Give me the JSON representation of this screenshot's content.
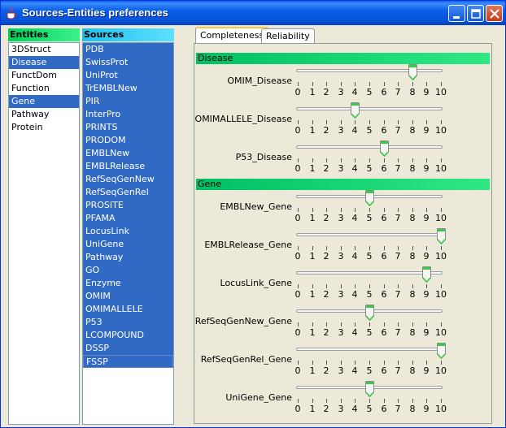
{
  "window": {
    "title": "Sources-Entities preferences"
  },
  "entities": {
    "header": "Entities",
    "items": [
      "3DStruct",
      "Disease",
      "FunctDom",
      "Function",
      "Gene",
      "Pathway",
      "Protein"
    ],
    "selected": [
      "Disease",
      "Gene"
    ]
  },
  "sources": {
    "header": "Sources",
    "items": [
      "PDB",
      "SwissProt",
      "UniProt",
      "TrEMBLNew",
      "PIR",
      "InterPro",
      "PRINTS",
      "PRODOM",
      "EMBLNew",
      "EMBLRelease",
      "RefSeqGenNew",
      "RefSeqGenRel",
      "PROSITE",
      "PFAMA",
      "LocusLink",
      "UniGene",
      "Pathway",
      "GO",
      "Enzyme",
      "OMIM",
      "OMIMALLELE",
      "P53",
      "LCOMPOUND",
      "DSSP",
      "FSSP"
    ]
  },
  "tabs": {
    "completeness": "Completeness",
    "reliability": "Reliability",
    "active": "Completeness"
  },
  "slider_scale": {
    "min": 0,
    "max": 10,
    "ticks": [
      "0",
      "1",
      "2",
      "3",
      "4",
      "5",
      "6",
      "7",
      "8",
      "9",
      "10"
    ]
  },
  "sections": [
    {
      "title": "Disease",
      "rows": [
        {
          "label": "OMIM_Disease",
          "value": 8
        },
        {
          "label": "OMIMALLELE_Disease",
          "value": 4
        },
        {
          "label": "P53_Disease",
          "value": 6
        }
      ]
    },
    {
      "title": "Gene",
      "rows": [
        {
          "label": "EMBLNew_Gene",
          "value": 5
        },
        {
          "label": "EMBLRelease_Gene",
          "value": 10
        },
        {
          "label": "LocusLink_Gene",
          "value": 9
        },
        {
          "label": "RefSeqGenNew_Gene",
          "value": 5
        },
        {
          "label": "RefSeqGenRel_Gene",
          "value": 10
        },
        {
          "label": "UniGene_Gene",
          "value": 5
        }
      ]
    }
  ],
  "colors": {
    "entities_header": "#00d25a",
    "sources_header": "#1ec0f0",
    "section_header": "#00c064",
    "selection": "#316ac5"
  }
}
